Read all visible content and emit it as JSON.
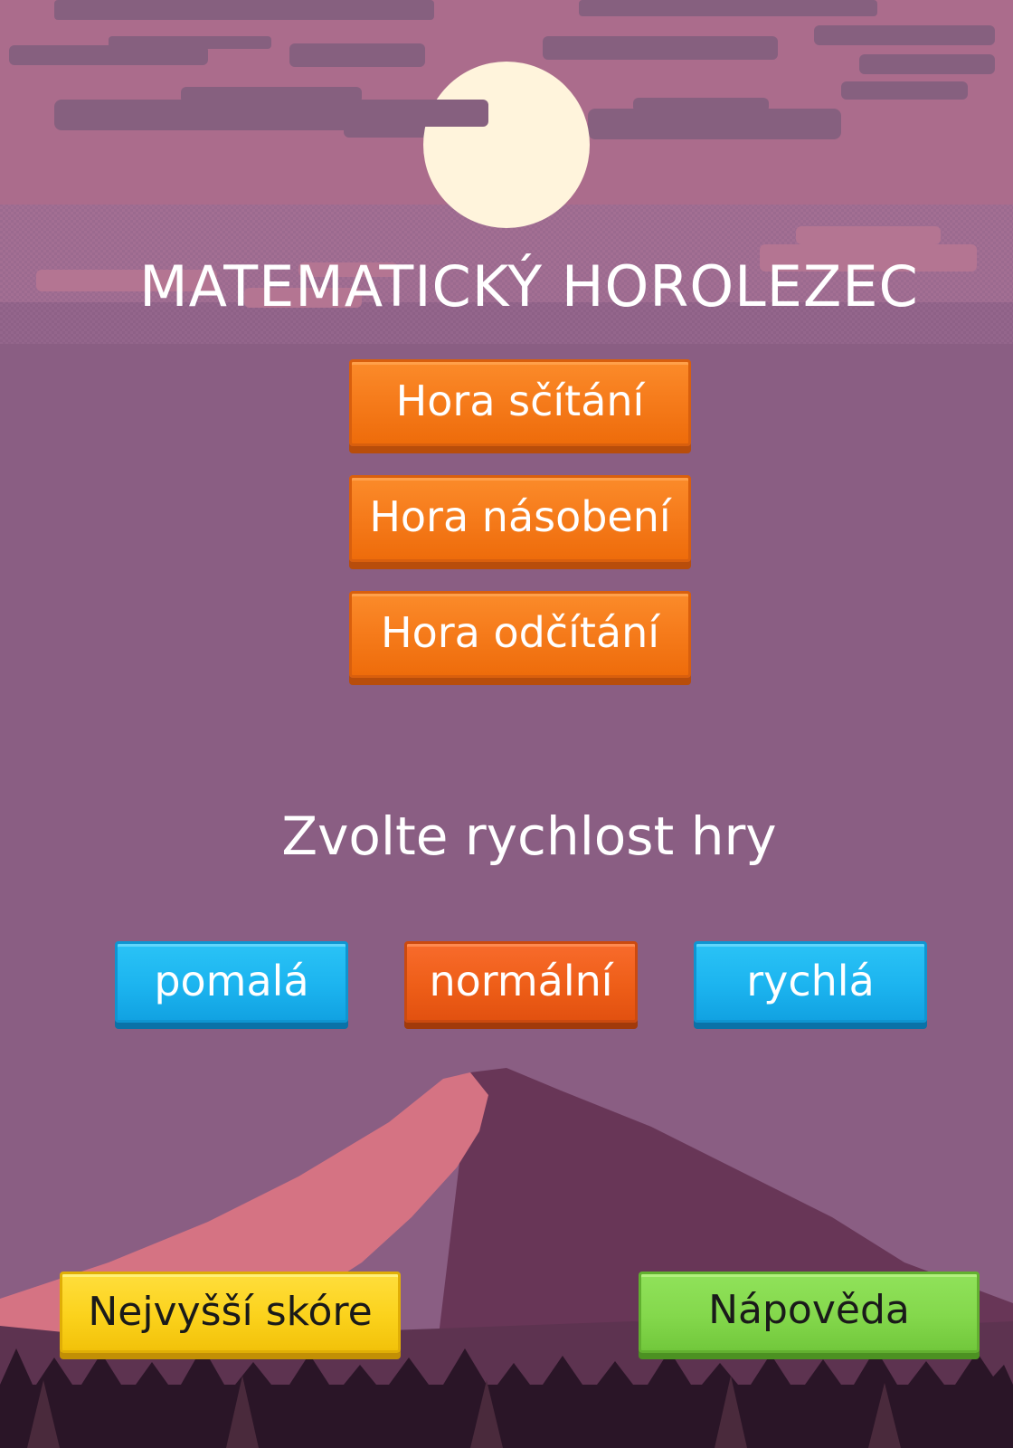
{
  "game": {
    "title": "MATEMATICKÝ HOROLEZEC",
    "speed_prompt": "Zvolte rychlost hry"
  },
  "modes": [
    {
      "label": "Hora sčítání"
    },
    {
      "label": "Hora násobení"
    },
    {
      "label": "Hora odčítání"
    }
  ],
  "speeds": [
    {
      "label": "pomalá",
      "selected": false
    },
    {
      "label": "normální",
      "selected": true
    },
    {
      "label": "rychlá",
      "selected": false
    }
  ],
  "footer": {
    "highscore_label": "Nejvyšší skóre",
    "help_label": "Nápověda"
  },
  "colors": {
    "sky": "#8a5e83",
    "mode_button": "#f67c1c",
    "speed_button": "#1cb4ef",
    "speed_selected": "#ee5e18",
    "highscore_button": "#fbd21c",
    "help_button": "#84d84c"
  }
}
